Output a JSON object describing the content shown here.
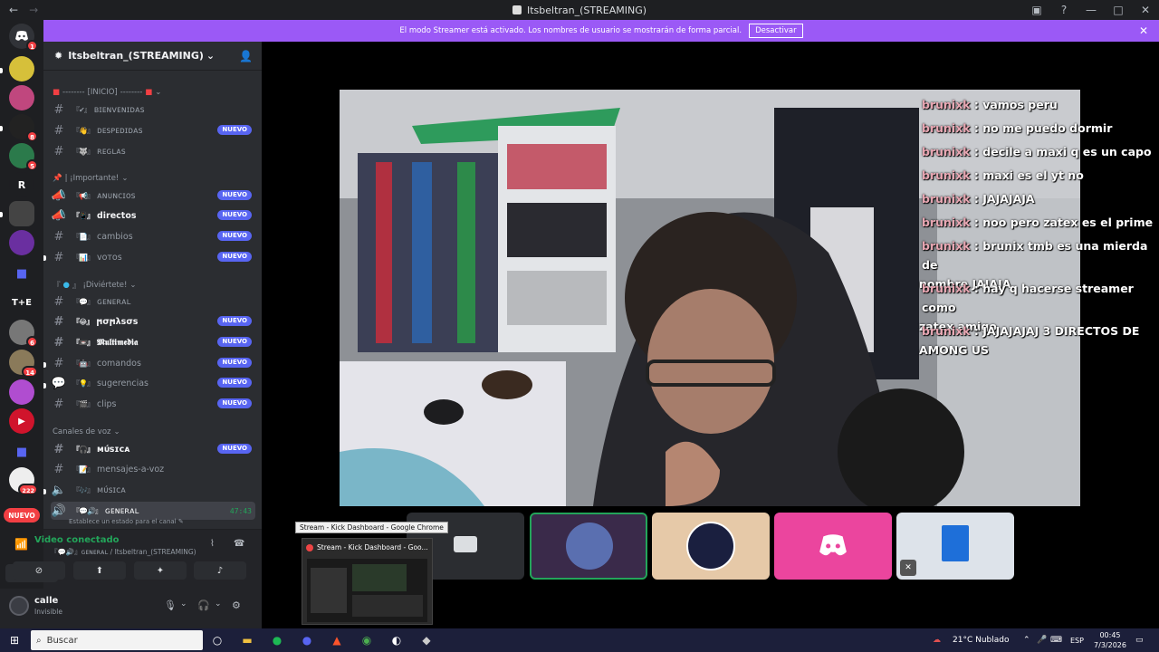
{
  "window": {
    "title": "Itsbeltran_(STREAMING)"
  },
  "banner": {
    "text": "El modo Streamer está activado. Los nombres de usuario se mostrarán de forma parcial.",
    "button": "Desactivar"
  },
  "rail": {
    "badges": [
      "1",
      "8",
      "5",
      "6",
      "14",
      "222"
    ],
    "letters": [
      "R",
      "T+E"
    ],
    "new_label": "NUEVO"
  },
  "server": {
    "name": "Itsbeltran_(STREAMING)"
  },
  "categories": {
    "inicio": "[INICIO]",
    "importante": "| ¡Importante!",
    "diviertete": "¡Diviértete!",
    "voz": "Canales de voz"
  },
  "channels": [
    {
      "name": "ʙɪᴇɴᴠᴇɴɪᴅᴀꜱ",
      "emoji": "『✔』",
      "new": ""
    },
    {
      "name": "ᴅᴇꜱᴘᴇᴅɪᴅᴀꜱ",
      "emoji": "『👋』",
      "new": "NUEVO"
    },
    {
      "name": "ʀᴇɢʟᴀꜱ",
      "emoji": "『🐺』",
      "new": ""
    },
    {
      "name": "ᴀɴᴜɴᴄɪᴏꜱ",
      "emoji": "『📢』",
      "new": "NUEVO"
    },
    {
      "name": "directos",
      "emoji": "『📱』",
      "new": "NUEVO"
    },
    {
      "name": "cambios",
      "emoji": "『📄』",
      "new": "NUEVO"
    },
    {
      "name": "ᴠᴏᴛᴏꜱ",
      "emoji": "『📊』",
      "new": "NUEVO"
    },
    {
      "name": "ɢᴇɴᴇʀᴀʟ",
      "emoji": "『💬』",
      "new": ""
    },
    {
      "name": "ϻσϻλѕσѕ",
      "emoji": "『😂』",
      "new": "NUEVO"
    },
    {
      "name": "𝕸𝖚𝖑𝖙𝖎𝖒𝖊𝖉𝖎𝖆",
      "emoji": "『📼』",
      "new": "NUEVO"
    },
    {
      "name": "comandos",
      "emoji": "『🤖』",
      "new": "NUEVO"
    },
    {
      "name": "sugerencias",
      "emoji": "『💡』",
      "new": "NUEVO"
    },
    {
      "name": "clips",
      "emoji": "『🎬』",
      "new": "NUEVO"
    },
    {
      "name": "ᴍᴜ́ꜱɪᴄᴀ",
      "emoji": "『🎧』",
      "new": "NUEVO"
    },
    {
      "name": "mensajes-a-voz",
      "emoji": "『📝』",
      "new": ""
    },
    {
      "name": "ᴍᴜ́ꜱɪᴄᴀ",
      "emoji": "『🎶』",
      "new": ""
    },
    {
      "name": "ɢᴇɴᴇʀᴀʟ",
      "emoji": "『💬🔊』",
      "new": "",
      "time": "47:43"
    }
  ],
  "status_hint": "Establece un estado para el canal",
  "voice": {
    "title": "Video conectado",
    "subtitle": "『💬🔊』ɢᴇɴᴇʀᴀʟ / Itsbeltran_(STREAMING)"
  },
  "user": {
    "name": "calle",
    "status": "Invisible"
  },
  "chat": [
    {
      "user": "brunixk",
      "msg": "vamos peru"
    },
    {
      "user": "brunixk",
      "msg": "no me puedo dormir"
    },
    {
      "user": "brunixk",
      "msg": "decile a maxi q es un capo"
    },
    {
      "user": "brunixk",
      "msg": "maxi es el yt no"
    },
    {
      "user": "brunixk",
      "msg": "JAJAJAJA"
    },
    {
      "user": "brunixk",
      "msg": "noo pero zatex es el prime"
    },
    {
      "user": "brunixk",
      "msg": "brunix tmb es una mierda de",
      "cont": "nombre JAJAJA"
    },
    {
      "user": "brunixk",
      "msg": "hay q hacerse streamer como",
      "cont": "zatex amigo"
    },
    {
      "user": "brunixk",
      "msg": "JAJAJAJAJ 3 DIRECTOS DE",
      "cont": "AMONG US"
    }
  ],
  "tooltip": "Stream - Kick Dashboard - Google Chrome",
  "thumb_title": "Stream - Kick Dashboard - Goo...",
  "taskbar": {
    "search": "Buscar",
    "weather": "21°C  Nublado",
    "lang": "ESP",
    "time": "00:45",
    "date": "7/3/2026"
  }
}
